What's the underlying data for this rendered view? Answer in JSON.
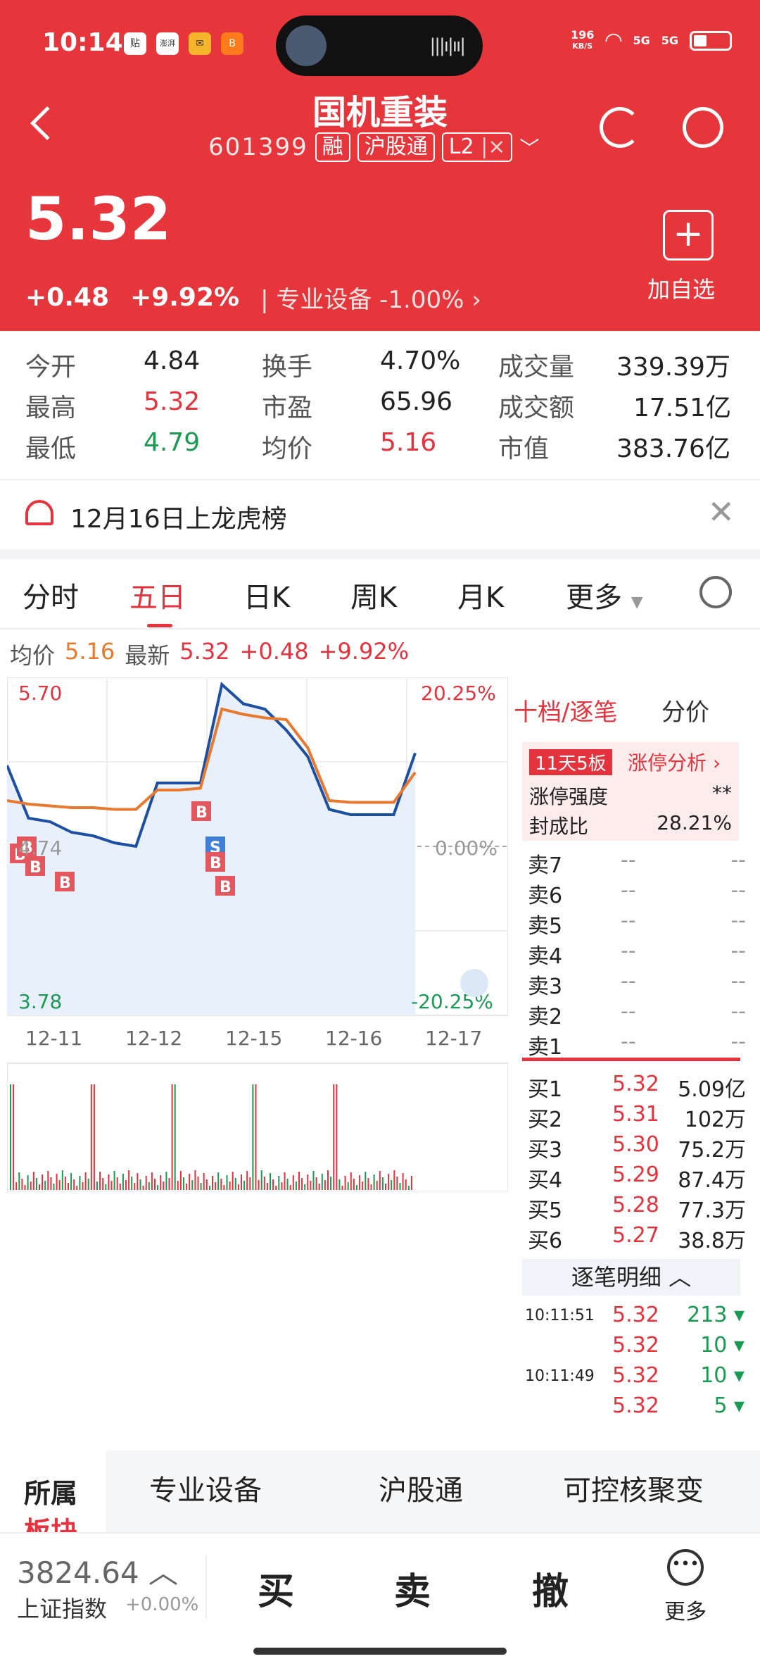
{
  "status_bar": {
    "time": "10:14",
    "net_speed_top": "196",
    "net_speed_unit": "KB/S",
    "signal1": "5G",
    "signal2": "5G",
    "apps": [
      "贴",
      "澎湃",
      "✉",
      "B"
    ]
  },
  "header": {
    "stock_name": "国机重装",
    "stock_code": "601399",
    "tags": [
      "融",
      "沪股通",
      "L2"
    ],
    "price": "5.32",
    "change": "+0.48",
    "change_pct": "+9.92%",
    "industry": "专业设备",
    "industry_pct": "-1.00%",
    "add_label": "加自选"
  },
  "stats": [
    {
      "label": "今开",
      "value": "4.84",
      "color": "normal"
    },
    {
      "label": "换手",
      "value": "4.70%",
      "color": "normal"
    },
    {
      "label": "成交量",
      "value": "339.39万",
      "color": "normal"
    },
    {
      "label": "最高",
      "value": "5.32",
      "color": "red"
    },
    {
      "label": "市盈",
      "value": "65.96",
      "color": "normal"
    },
    {
      "label": "成交额",
      "value": "17.51亿",
      "color": "normal"
    },
    {
      "label": "最低",
      "value": "4.79",
      "color": "green"
    },
    {
      "label": "均价",
      "value": "5.16",
      "color": "red"
    },
    {
      "label": "市值",
      "value": "383.76亿",
      "color": "normal"
    }
  ],
  "notice": {
    "text": "12月16日上龙虎榜"
  },
  "tabs": [
    "分时",
    "五日",
    "日K",
    "周K",
    "月K",
    "更多"
  ],
  "active_tab": "五日",
  "infobar": {
    "avg_label": "均价",
    "avg_value": "5.16",
    "latest_label": "最新",
    "latest_value": "5.32",
    "chg": "+0.48",
    "pct": "+9.92%"
  },
  "chart_data": {
    "type": "line",
    "x": [
      "12-11",
      "12-12",
      "12-15",
      "12-16",
      "12-17"
    ],
    "y_left": {
      "top": "5.70",
      "mid": "4.74",
      "bottom": "3.78"
    },
    "y_right": {
      "top": "20.25%",
      "mid": "0.00%",
      "bottom": "-20.25%"
    },
    "series": [
      {
        "name": "最新",
        "color": "#1d4fa3",
        "values": [
          5.2,
          4.9,
          4.88,
          4.82,
          4.8,
          4.76,
          4.74,
          5.1,
          5.1,
          5.1,
          5.66,
          5.55,
          5.52,
          5.4,
          5.25,
          4.95,
          4.92,
          4.92,
          4.92,
          5.27
        ]
      },
      {
        "name": "均价",
        "color": "#e8792e",
        "values": [
          5.0,
          4.98,
          4.97,
          4.96,
          4.96,
          4.95,
          4.95,
          5.06,
          5.06,
          5.07,
          5.52,
          5.49,
          5.47,
          5.46,
          5.3,
          5.0,
          4.99,
          4.99,
          4.99,
          5.16
        ]
      }
    ],
    "markers": [
      "B",
      "B",
      "B",
      "B",
      "S",
      "B",
      "B",
      "B"
    ]
  },
  "orderbook": {
    "tab1": "十档/逐笔",
    "tab2": "分价",
    "badge": "11天5板",
    "analysis": "涨停分析",
    "strength_label": "涨停强度",
    "strength_value": "**",
    "seal_label": "封成比",
    "seal_value": "28.21%",
    "sells": [
      {
        "label": "卖7",
        "p": "--",
        "v": "--"
      },
      {
        "label": "卖6",
        "p": "--",
        "v": "--"
      },
      {
        "label": "卖5",
        "p": "--",
        "v": "--"
      },
      {
        "label": "卖4",
        "p": "--",
        "v": "--"
      },
      {
        "label": "卖3",
        "p": "--",
        "v": "--"
      },
      {
        "label": "卖2",
        "p": "--",
        "v": "--"
      },
      {
        "label": "卖1",
        "p": "--",
        "v": "--"
      }
    ],
    "buys": [
      {
        "label": "买1",
        "p": "5.32",
        "v": "5.09亿"
      },
      {
        "label": "买2",
        "p": "5.31",
        "v": "102万"
      },
      {
        "label": "买3",
        "p": "5.30",
        "v": "75.2万"
      },
      {
        "label": "买4",
        "p": "5.29",
        "v": "87.4万"
      },
      {
        "label": "买5",
        "p": "5.28",
        "v": "77.3万"
      },
      {
        "label": "买6",
        "p": "5.27",
        "v": "38.8万"
      }
    ],
    "ticks_title": "逐笔明细",
    "ticks": [
      {
        "t": "10:11:51",
        "p": "5.32",
        "v": "213"
      },
      {
        "t": "",
        "p": "5.32",
        "v": "10"
      },
      {
        "t": "10:11:49",
        "p": "5.32",
        "v": "10"
      },
      {
        "t": "",
        "p": "5.32",
        "v": "5"
      }
    ]
  },
  "sector": {
    "label1": "所属",
    "label2": "板块",
    "items": [
      "专业设备",
      "沪股通",
      "可控核聚变"
    ]
  },
  "bottom_bar": {
    "index_value": "3824.64",
    "index_name": "上证指数",
    "index_chg": "+0.00%",
    "buy": "买",
    "sell": "卖",
    "cancel": "撤",
    "more": "更多"
  }
}
